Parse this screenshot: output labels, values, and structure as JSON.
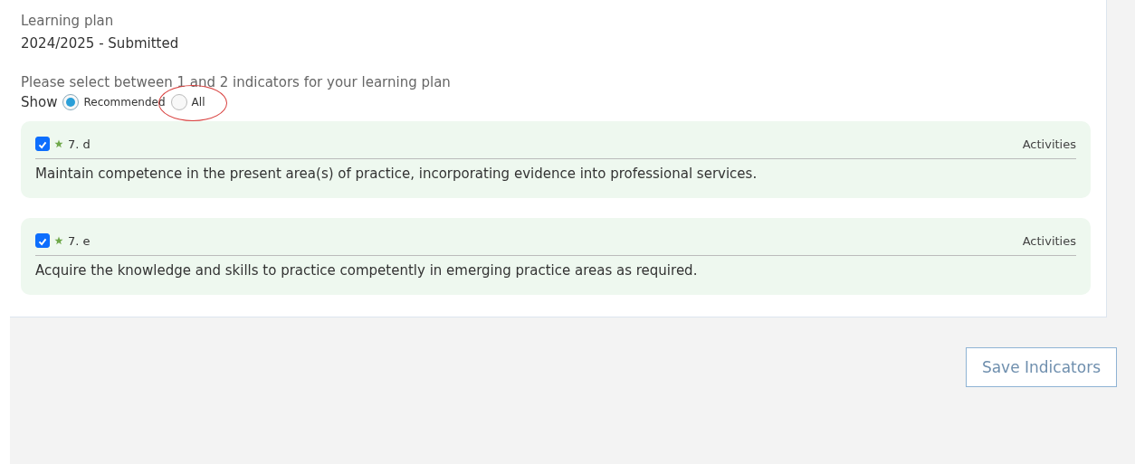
{
  "plan": {
    "label": "Learning plan",
    "value": "2024/2025 - Submitted"
  },
  "instruction": "Please select between 1 and 2 indicators for your learning plan",
  "filter": {
    "label": "Show",
    "options": [
      {
        "label": "Recommended",
        "selected": true
      },
      {
        "label": "All",
        "selected": false,
        "circled": true
      }
    ]
  },
  "indicators": [
    {
      "code": "7. d",
      "checked": true,
      "recommended": true,
      "link": "Activities",
      "description": "Maintain competence in the present area(s) of practice, incorporating evidence into professional services."
    },
    {
      "code": "7. e",
      "checked": true,
      "recommended": true,
      "link": "Activities",
      "description": "Acquire the knowledge and skills to practice competently in emerging practice areas as required."
    }
  ],
  "save_button": "Save Indicators"
}
